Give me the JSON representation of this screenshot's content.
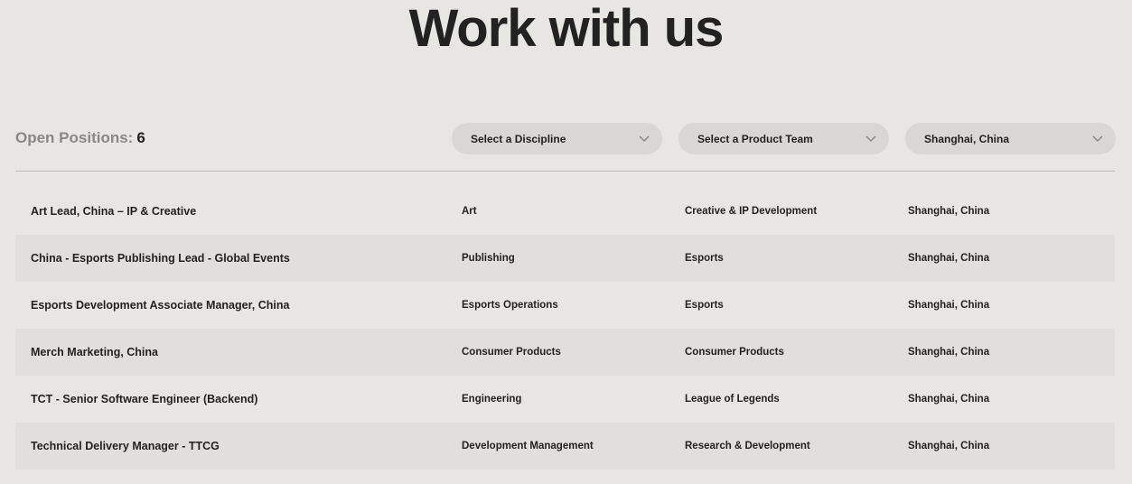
{
  "header": {
    "title": "Work with us"
  },
  "filters": {
    "open_positions_label": "Open Positions:",
    "open_positions_count": "6",
    "discipline": "Select a Discipline",
    "product_team": "Select a Product Team",
    "location": "Shanghai, China"
  },
  "jobs": [
    {
      "title": "Art Lead, China – IP & Creative",
      "discipline": "Art",
      "team": "Creative & IP Development",
      "location": "Shanghai, China"
    },
    {
      "title": "China - Esports Publishing Lead - Global Events",
      "discipline": "Publishing",
      "team": "Esports",
      "location": "Shanghai, China"
    },
    {
      "title": "Esports Development Associate Manager, China",
      "discipline": "Esports Operations",
      "team": "Esports",
      "location": "Shanghai, China"
    },
    {
      "title": "Merch Marketing, China",
      "discipline": "Consumer Products",
      "team": "Consumer Products",
      "location": "Shanghai, China"
    },
    {
      "title": "TCT - Senior Software Engineer (Backend)",
      "discipline": "Engineering",
      "team": "League of Legends",
      "location": "Shanghai, China"
    },
    {
      "title": "Technical Delivery Manager - TTCG",
      "discipline": "Development Management",
      "team": "Research & Development",
      "location": "Shanghai, China"
    }
  ],
  "icons": {
    "dropdown": "chevron-down-icon"
  },
  "colors": {
    "background": "#e8e6e2",
    "row_alt": "#e0dfdb",
    "select_bg": "#d9d7d3",
    "muted_text": "#8a8784"
  }
}
